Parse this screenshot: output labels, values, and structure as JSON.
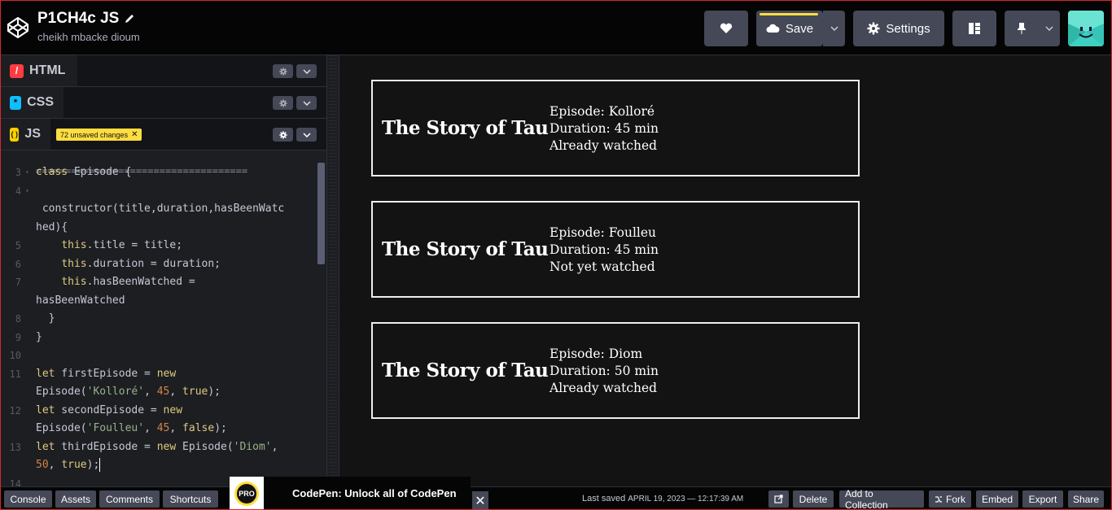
{
  "header": {
    "pen_title": "P1CH4c JS",
    "author": "cheikh mbacke dioum",
    "save_label": "Save",
    "settings_label": "Settings",
    "icons": [
      "codepen-logo-icon",
      "pencil-icon",
      "heart-icon",
      "cloud-icon",
      "chevron-down-icon",
      "gear-icon",
      "layout-icon",
      "pin-icon",
      "avatar"
    ]
  },
  "editors": {
    "html_label": "HTML",
    "css_label": "CSS",
    "js_label": "JS",
    "unsaved_badge": "72 unsaved changes",
    "unsaved_close": "✕"
  },
  "code": {
    "partial_top": "====================================",
    "lines": [
      {
        "n": "3",
        "fold": true,
        "text": "class Episode {"
      },
      {
        "n": "4",
        "fold": true,
        "text": ""
      },
      {
        "n": "",
        "fold": false,
        "text": " constructor(title,duration,hasBeenWatc"
      },
      {
        "n": "",
        "fold": false,
        "text": "hed){"
      },
      {
        "n": "5",
        "fold": false,
        "text": "    this.title = title;"
      },
      {
        "n": "6",
        "fold": false,
        "text": "    this.duration = duration;"
      },
      {
        "n": "7",
        "fold": false,
        "text": "    this.hasBeenWatched ="
      },
      {
        "n": "",
        "fold": false,
        "text": "hasBeenWatched"
      },
      {
        "n": "8",
        "fold": false,
        "text": "  }"
      },
      {
        "n": "9",
        "fold": false,
        "text": "}"
      },
      {
        "n": "10",
        "fold": false,
        "text": ""
      },
      {
        "n": "11",
        "fold": false,
        "text": "let firstEpisode = new"
      },
      {
        "n": "",
        "fold": false,
        "text": "Episode('Kolloré', 45, true);"
      },
      {
        "n": "12",
        "fold": false,
        "text": "let secondEpisode = new"
      },
      {
        "n": "",
        "fold": false,
        "text": "Episode('Foulleu', 45, false);"
      },
      {
        "n": "13",
        "fold": false,
        "text": "let thirdEpisode = new Episode('Diom',"
      },
      {
        "n": "",
        "fold": false,
        "text": "50, true);"
      },
      {
        "n": "14",
        "fold": false,
        "text": ""
      }
    ]
  },
  "preview": {
    "cards": [
      {
        "title": "The Story of Tau",
        "episode": "Episode: Kolloré",
        "duration": "Duration: 45 min",
        "status": "Already watched"
      },
      {
        "title": "The Story of Tau",
        "episode": "Episode: Foulleu",
        "duration": "Duration: 45 min",
        "status": "Not yet watched"
      },
      {
        "title": "The Story of Tau",
        "episode": "Episode: Diom",
        "duration": "Duration: 50 min",
        "status": "Already watched"
      }
    ]
  },
  "footer": {
    "console": "Console",
    "assets": "Assets",
    "comments": "Comments",
    "shortcuts": "Shortcuts",
    "promo_badge": "PRO",
    "promo_text": "CodePen: Unlock all of CodePen",
    "promo_close": "✕",
    "last_saved_label": "Last saved",
    "last_saved_date": "APRIL 19, 2023 — 12:17:39 AM",
    "delete": "Delete",
    "add_to_collection": "Add to Collection",
    "fork": "Fork",
    "embed": "Embed",
    "export": "Export",
    "share": "Share"
  },
  "colors": {
    "accent": "#ffdd40",
    "button_bg": "#444857",
    "html_icon": "#ff3c41",
    "css_icon": "#0ebeff",
    "js_icon": "#fcd000"
  }
}
